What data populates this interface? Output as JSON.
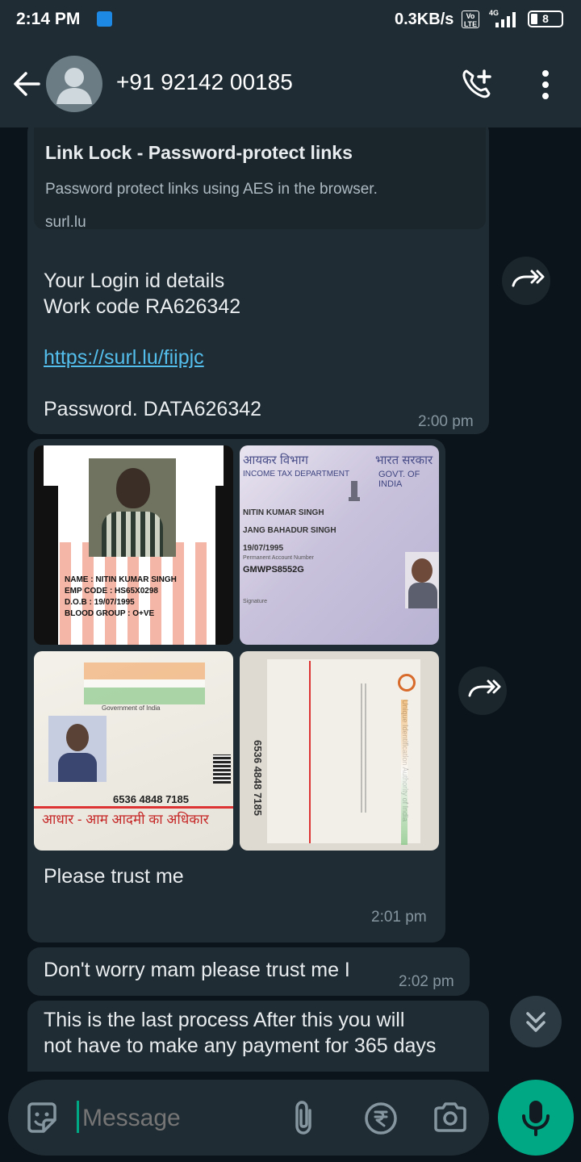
{
  "status_bar": {
    "time": "2:14 PM",
    "speed": "0.3KB/s",
    "volte": "Vo LTE",
    "network": "4G",
    "battery": "8"
  },
  "header": {
    "contact": "+91 92142 00185"
  },
  "messages": {
    "m1": {
      "preview_title": "Link Lock - Password-protect links",
      "preview_desc": "Password protect links using AES in the browser.",
      "preview_domain": "surl.lu",
      "line1": "Your Login id details",
      "line2": "Work code  RA626342",
      "link": "https://surl.lu/fiipjc",
      "line3": "Password.  DATA626342",
      "time": "2:00 pm"
    },
    "m2": {
      "card1": {
        "name": "NAME : NITIN KUMAR SINGH",
        "emp": "EMP CODE : HS65X0298",
        "dob": "D.O.B : 19/07/1995",
        "blood": "BLOOD GROUP : O+VE"
      },
      "card2": {
        "hindi_left": "आयकर विभाग",
        "hindi_right": "भारत सरकार",
        "dept": "INCOME TAX DEPARTMENT",
        "govt": "GOVT. OF INDIA",
        "name": "NITIN KUMAR SINGH",
        "father": "JANG BAHADUR SINGH",
        "dob": "19/07/1995",
        "pan_label": "Permanent Account Number",
        "pan": "GMWPS8552G",
        "sig_label": "Signature"
      },
      "card3": {
        "govt": "Government of India",
        "number": "6536 4848 7185",
        "tagline": "आधार - आम आदमी का अधिकार"
      },
      "card4": {
        "number": "6536 4848 7185",
        "authority": "Unique Identification Authority of India"
      },
      "text": "Please trust me",
      "time": "2:01 pm"
    },
    "m3": {
      "text": "Don't worry mam please trust me I",
      "time": "2:02 pm"
    },
    "m4": {
      "line1": "This is the last process After this you will",
      "line2": "not have to make any payment for 365 days"
    }
  },
  "input": {
    "placeholder": "Message"
  },
  "colors": {
    "accent": "#00a884",
    "bubble": "#202c33",
    "header": "#1f2c33",
    "background": "#0b141a",
    "link": "#53bdeb"
  },
  "icons": [
    "back-arrow-icon",
    "avatar-icon",
    "add-call-icon",
    "more-options-icon",
    "forward-icon",
    "scroll-down-icon",
    "sticker-icon",
    "attach-icon",
    "rupee-icon",
    "camera-icon",
    "mic-icon"
  ]
}
